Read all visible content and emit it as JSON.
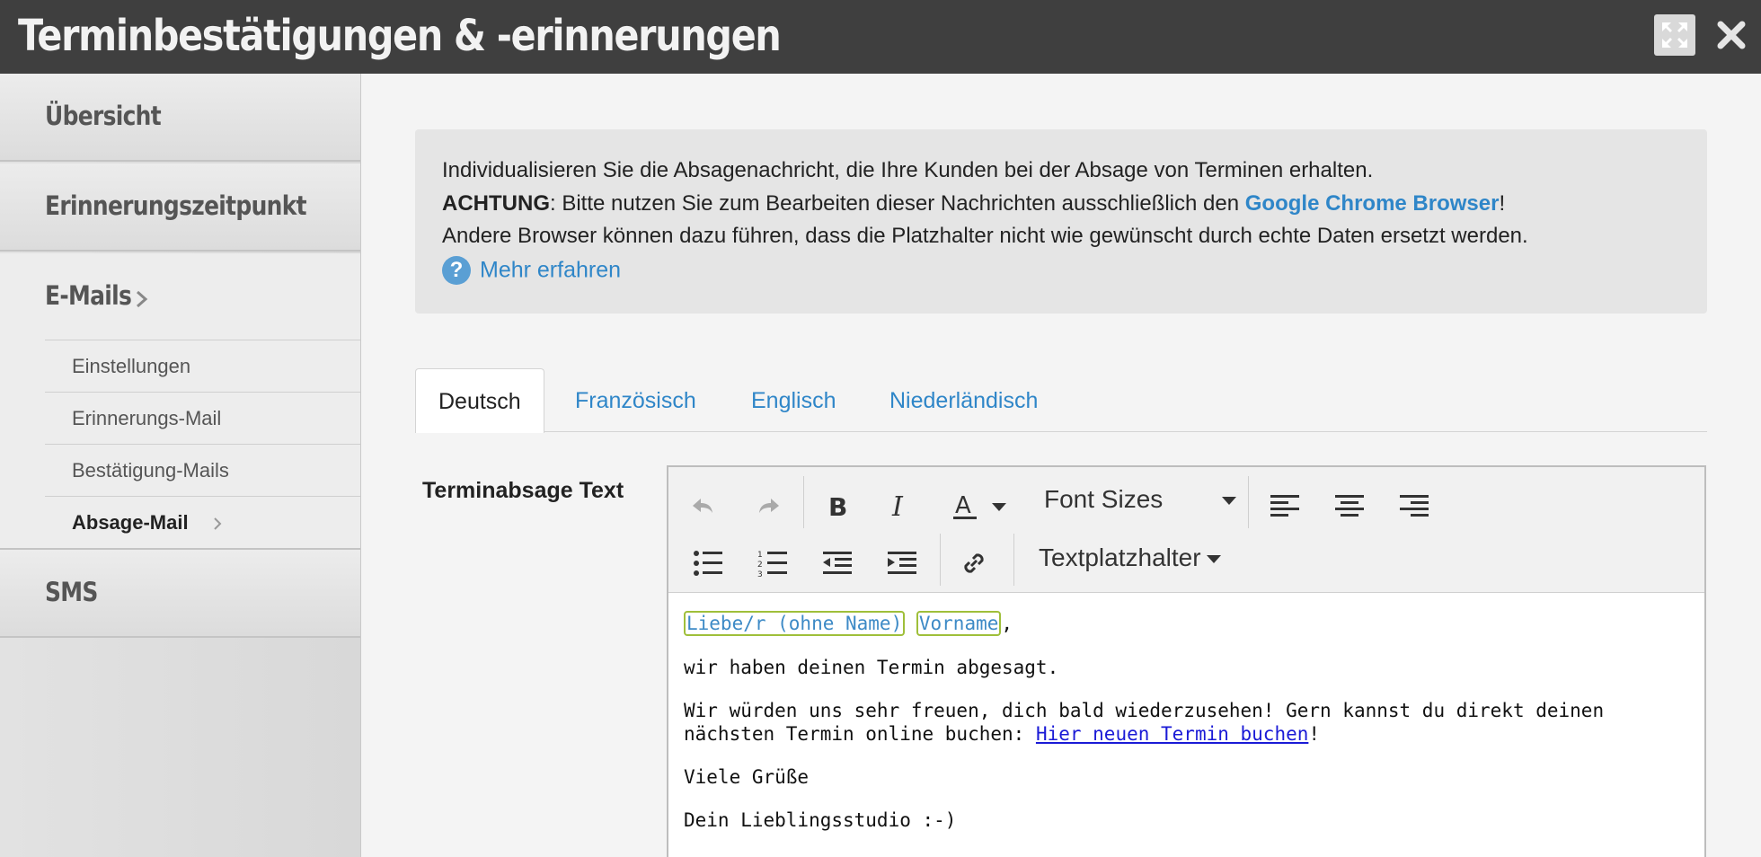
{
  "window": {
    "title": "Terminbestätigungen & -erinnerungen"
  },
  "sidebar": {
    "items": [
      {
        "label": "Übersicht"
      },
      {
        "label": "Erinnerungszeitpunkt"
      },
      {
        "label": "E-Mails"
      },
      {
        "label": "SMS"
      }
    ],
    "email_sub_items": [
      {
        "label": "Einstellungen"
      },
      {
        "label": "Erinnerungs-Mail"
      },
      {
        "label": "Bestätigung-Mails"
      },
      {
        "label": "Absage-Mail",
        "active": true
      }
    ]
  },
  "info": {
    "line1": "Individualisieren Sie die Absagenachricht, die Ihre Kunden bei der Absage von Terminen erhalten.",
    "achtung": "ACHTUNG",
    "line2_text": ": Bitte nutzen Sie zum Bearbeiten dieser Nachrichten ausschließlich den ",
    "chrome_link": "Google Chrome Browser",
    "line2_end": "!",
    "line3": "Andere Browser können dazu führen, dass die Platzhalter nicht wie gewünscht durch echte Daten ersetzt werden.",
    "help_icon": "?",
    "more_link": "Mehr erfahren"
  },
  "tabs": [
    {
      "label": "Deutsch",
      "active": true
    },
    {
      "label": "Französisch"
    },
    {
      "label": "Englisch"
    },
    {
      "label": "Niederländisch"
    }
  ],
  "editor": {
    "field_label": "Terminabsage Text",
    "toolbar": {
      "font_sizes": "Font Sizes",
      "placeholder_menu": "Textplatzhalter"
    },
    "content": {
      "placeholder1": "Liebe/r (ohne Name)",
      "placeholder2": "Vorname",
      "comma": ",",
      "p1": "wir haben deinen Termin abgesagt.",
      "p2_text": "Wir würden uns sehr freuen, dich bald wiederzusehen! Gern kannst du direkt deinen nächsten Termin online buchen: ",
      "p2_link": "Hier neuen Termin buchen",
      "p2_end": "!",
      "p3": "Viele Grüße",
      "p4": "Dein Lieblingsstudio :-)"
    }
  },
  "colors": {
    "titlebar": "#3f3f3f",
    "link": "#2f86c8",
    "placeholder_border": "#9fbf3a"
  }
}
